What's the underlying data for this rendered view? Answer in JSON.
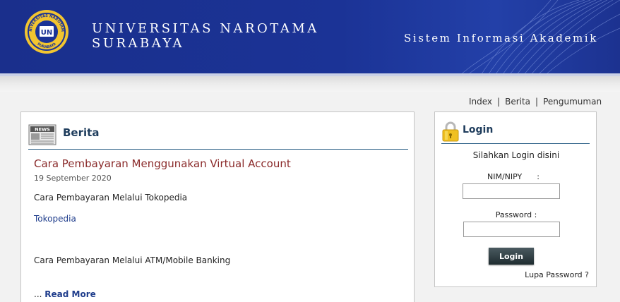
{
  "header": {
    "university_line1": "UNIVERSITAS NAROTAMA",
    "university_line2": "SURABAYA",
    "system_title": "Sistem Informasi Akademik",
    "logo_text_top": "UNIVERSITAS NAROTAMA",
    "logo_text_bottom": "SURABAYA",
    "logo_center": "UN",
    "colors": {
      "header_bg": "#1b3396",
      "accent_gold": "#f2c530"
    }
  },
  "topnav": {
    "items": [
      {
        "label": "Index"
      },
      {
        "label": "Berita"
      },
      {
        "label": "Pengumuman"
      }
    ],
    "separator": "|"
  },
  "berita": {
    "heading": "Berita",
    "icon": "newspaper-icon",
    "icon_text": "NEWS",
    "article": {
      "title": "Cara Pembayaran Menggunakan Virtual Account",
      "date": "19 September 2020",
      "paragraph1": "Cara Pembayaran Melalui Tokopedia",
      "link1": "Tokopedia",
      "paragraph2": "Cara Pembayaran Melalui ATM/Mobile Banking",
      "read_more_prefix": "...",
      "read_more_label": "Read More"
    },
    "colors": {
      "title": "#8a2a2a",
      "link": "#1f3d8c"
    }
  },
  "login": {
    "heading": "Login",
    "icon": "lock-icon",
    "hint": "Silahkan Login disini",
    "nim_label": "NIM/NIPY      :",
    "nim_value": "",
    "password_label": "Password :",
    "password_value": "",
    "button_label": "Login",
    "forgot_label": "Lupa Password ?"
  }
}
